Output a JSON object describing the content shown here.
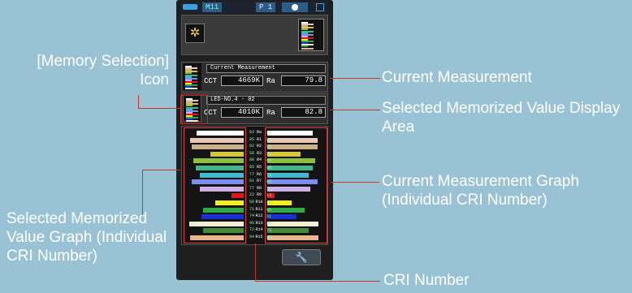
{
  "status": {
    "memory": "M11",
    "program": "P 1"
  },
  "current": {
    "title": "Current Measurement",
    "cct_label": "CCT",
    "cct": "4669K",
    "ra_label": "Ra",
    "ra": "79.8"
  },
  "memorized": {
    "title": "LED-NO.4 - 02",
    "cct_label": "CCT",
    "cct": "4010K",
    "ra_label": "Ra",
    "ra": "82.8"
  },
  "graph": {
    "labels": [
      "Ra",
      "R1",
      "R2",
      "R3",
      "R4",
      "R5",
      "R6",
      "R7",
      "R8",
      "R9",
      "R10",
      "R11",
      "R12",
      "R13",
      "R14",
      "R15"
    ],
    "memorized": [
      83,
      95,
      92,
      58,
      88,
      85,
      77,
      91,
      77,
      22,
      50,
      71,
      74,
      96,
      72,
      94
    ],
    "current": [
      80,
      89,
      88,
      58,
      84,
      80,
      73,
      89,
      75,
      13,
      43,
      66,
      51,
      90,
      73,
      90
    ],
    "colors": [
      "#ffffff",
      "#e6c8b4",
      "#c9b08a",
      "#d6c835",
      "#8bbf3c",
      "#44b48a",
      "#3fbad0",
      "#7c8ff0",
      "#cfb0e6",
      "#e41616",
      "#f2ef18",
      "#2fa846",
      "#1a2fd0",
      "#f2eed6",
      "#3f8c3a",
      "#e8b48e"
    ]
  },
  "annotations": {
    "memory_icon": "[Memory Selection] Icon",
    "current_measurement": "Current Measurement",
    "selected_area": "Selected Memorized Value Display Area",
    "current_graph": "Current Measurement Graph (Individual CRI Number)",
    "selected_graph": "Selected Memorized Value Graph (Individual CRI Number)",
    "cri_number": "CRI Number"
  },
  "icons": {
    "lamp": "light-source-icon",
    "tool": "wrench-icon"
  }
}
